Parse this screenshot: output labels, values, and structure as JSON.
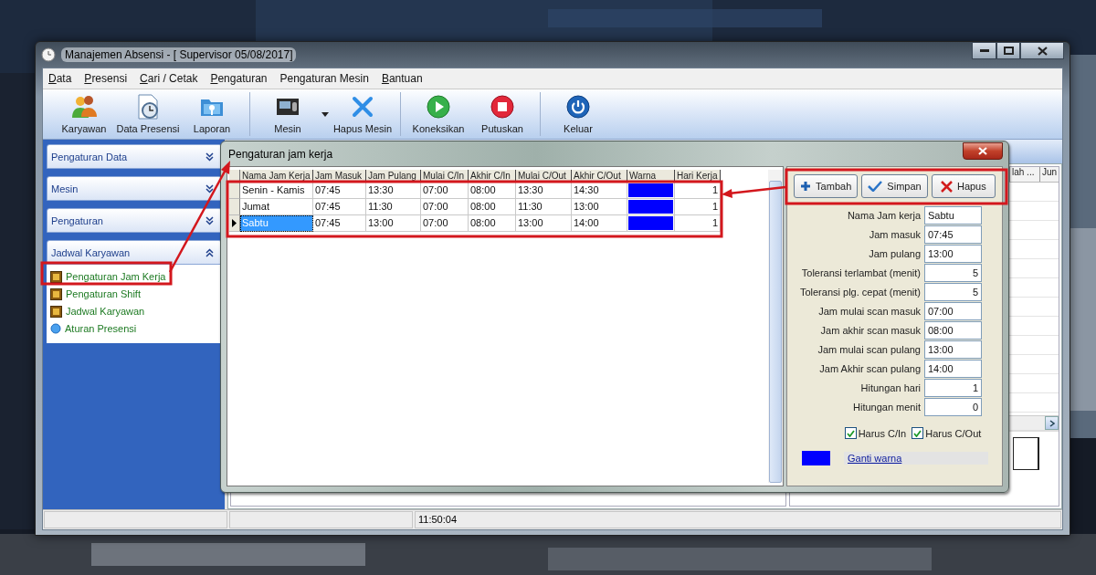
{
  "window": {
    "title": "Manajemen Absensi - [ Supervisor 05/08/2017]"
  },
  "menu": [
    {
      "label": "Data",
      "underline_first": true
    },
    {
      "label": "Presensi",
      "underline_first": true
    },
    {
      "label": "Cari / Cetak",
      "underline_first": true
    },
    {
      "label": "Pengaturan",
      "underline_first": true
    },
    {
      "label": "Pengaturan Mesin",
      "underline_first": false
    },
    {
      "label": "Bantuan",
      "underline_first": true
    }
  ],
  "toolbar": {
    "groups": [
      [
        {
          "label": "Karyawan",
          "kind": "people",
          "dropdown": false
        },
        {
          "label": "Data Presensi",
          "kind": "document-clock",
          "dropdown": false
        },
        {
          "label": "Laporan",
          "kind": "folder",
          "dropdown": false
        }
      ],
      [
        {
          "label": "Mesin",
          "kind": "device",
          "dropdown": true
        },
        {
          "label": "Hapus Mesin",
          "kind": "cross",
          "dropdown": false
        }
      ],
      [
        {
          "label": "Koneksikan",
          "kind": "play",
          "dropdown": false
        },
        {
          "label": "Putuskan",
          "kind": "stop",
          "dropdown": false
        }
      ],
      [
        {
          "label": "Keluar",
          "kind": "power",
          "dropdown": false
        }
      ]
    ]
  },
  "sidebar": {
    "sections": [
      {
        "title": "Pengaturan Data",
        "expanded": false
      },
      {
        "title": "Mesin",
        "expanded": false
      },
      {
        "title": "Pengaturan",
        "expanded": false
      },
      {
        "title": "Jadwal Karyawan",
        "expanded": true,
        "items": [
          {
            "label": "Pengaturan Jam Kerja",
            "kind": "tile"
          },
          {
            "label": "Pengaturan Shift",
            "kind": "tile"
          },
          {
            "label": "Jadwal Karyawan",
            "kind": "tile"
          },
          {
            "label": "Aturan Presensi",
            "kind": "dot"
          }
        ]
      }
    ]
  },
  "background_window": {
    "columns": [
      "lah ...",
      "Jun"
    ]
  },
  "dialog": {
    "title": "Pengaturan jam kerja",
    "table": {
      "columns": [
        "Nama Jam Kerja",
        "Jam Masuk",
        "Jam Pulang",
        "Mulai C/In",
        "Akhir C/In",
        "Mulai C/Out",
        "Akhir C/Out",
        "Warna",
        "Hari Kerja"
      ],
      "rows": [
        {
          "cells": [
            "Senin - Kamis",
            "07:45",
            "13:30",
            "07:00",
            "08:00",
            "13:30",
            "14:30"
          ],
          "color": "#0000ff",
          "hari_kerja": "1",
          "selected": false
        },
        {
          "cells": [
            "Jumat",
            "07:45",
            "11:30",
            "07:00",
            "08:00",
            "11:30",
            "13:00"
          ],
          "color": "#0000ff",
          "hari_kerja": "1",
          "selected": false
        },
        {
          "cells": [
            "Sabtu",
            "07:45",
            "13:00",
            "07:00",
            "08:00",
            "13:00",
            "14:00"
          ],
          "color": "#0000ff",
          "hari_kerja": "1",
          "selected": true
        }
      ]
    },
    "buttons": [
      {
        "label": "Tambah",
        "kind": "add"
      },
      {
        "label": "Simpan",
        "kind": "save"
      },
      {
        "label": "Hapus",
        "kind": "delete"
      }
    ],
    "form": [
      {
        "label": "Nama Jam kerja",
        "value": "Sabtu",
        "kind": "text"
      },
      {
        "label": "Jam masuk",
        "value": "07:45",
        "kind": "text"
      },
      {
        "label": "Jam pulang",
        "value": "13:00",
        "kind": "text"
      },
      {
        "label": "Toleransi terlambat (menit)",
        "value": "5",
        "kind": "number"
      },
      {
        "label": "Toleransi plg. cepat (menit)",
        "value": "5",
        "kind": "number"
      },
      {
        "label": "Jam mulai scan masuk",
        "value": "07:00",
        "kind": "text"
      },
      {
        "label": "Jam akhir scan masuk",
        "value": "08:00",
        "kind": "text"
      },
      {
        "label": "Jam mulai scan pulang",
        "value": "13:00",
        "kind": "text"
      },
      {
        "label": "Jam Akhir scan pulang",
        "value": "14:00",
        "kind": "text"
      },
      {
        "label": "Hitungan hari",
        "value": "1",
        "kind": "number"
      },
      {
        "label": "Hitungan menit",
        "value": "0",
        "kind": "number"
      }
    ],
    "checkboxes": [
      {
        "label": "Harus C/In",
        "checked": true
      },
      {
        "label": "Harus C/Out",
        "checked": true
      }
    ],
    "color_picker": {
      "color": "#0000ff",
      "link": "Ganti warna"
    }
  },
  "status_bar": {
    "time": "11:50:04"
  }
}
